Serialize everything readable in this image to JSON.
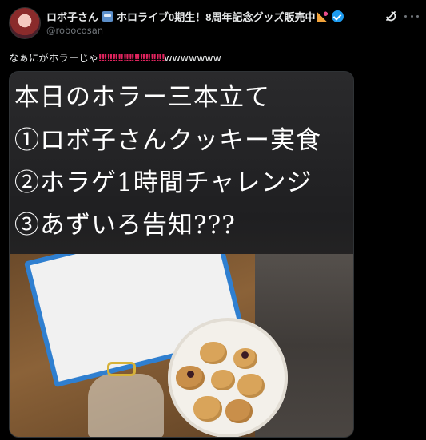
{
  "author": {
    "display_name": "ロボ子さん",
    "display_name_suffix": "ホロライブ0期生！8周年記念グッズ販売中",
    "handle": "@robocosan"
  },
  "icons": {
    "avatar": "avatar-image",
    "emoji_1": "robot-emoji-icon",
    "emoji_2": "party-popper-emoji-icon",
    "verified": "verified-badge-icon",
    "grok": "grok-icon",
    "more": "more-icon"
  },
  "colors": {
    "background": "#000000",
    "text": "#e7e9ea",
    "secondary_text": "#71767b",
    "verified": "#1d9bf0",
    "exclamation": "#e0245e"
  },
  "tweet": {
    "text_before": "なぁにがホラーじゃ",
    "exclamations": "‼‼‼‼‼‼‼‼‼‼‼‼",
    "text_after": "wwwwwww"
  },
  "media": {
    "headline_lines": [
      "本日のホラー三本立て",
      "①ロボ子さんクッキー実食",
      "②ホラゲ1時間チャレンジ",
      "③あずいろ告知???"
    ]
  }
}
